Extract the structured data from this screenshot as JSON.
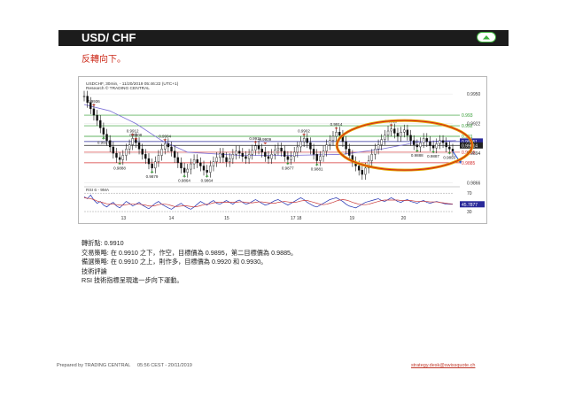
{
  "header": {
    "title": "USD/ CHF",
    "nav_icon": "chevron-up-icon"
  },
  "subtitle": "反轉向下。",
  "chart_data": {
    "type": "line",
    "info_line_1": "USDCHF, 30min, - 11/20/2019 05:46:22 (UTC+1)",
    "info_line_2": "Research © TRADING CENTRAL",
    "ylim": [
      0.9864,
      0.9956
    ],
    "yticks": [
      0.995,
      0.9922,
      0.9894,
      0.9866
    ],
    "x_dates": [
      "13",
      "14",
      "15",
      "17 18",
      "19",
      "20"
    ],
    "levels": [
      {
        "value": 0.993,
        "label": "0.993",
        "color": "#2e9a2e"
      },
      {
        "value": 0.992,
        "label": "0.992",
        "color": "#2e9a2e"
      },
      {
        "value": 0.991,
        "label": "0.991",
        "color": "#2e9a2e"
      },
      {
        "value": 0.99051,
        "label": "0.99051",
        "color": "#2a2a9a"
      },
      {
        "value": 0.99014,
        "label": "0.99014",
        "color": "#222222"
      },
      {
        "value": 0.9895,
        "label": "0.9895",
        "color": "#d43030"
      },
      {
        "value": 0.9885,
        "label": "0.9885",
        "color": "#d43030"
      }
    ],
    "price": [
      0.9948,
      0.9942,
      0.9936,
      0.993,
      0.9925,
      0.9918,
      0.9912,
      0.9906,
      0.99,
      0.9894,
      0.989,
      0.9888,
      0.9892,
      0.9898,
      0.9902,
      0.9908,
      0.9904,
      0.9898,
      0.9893,
      0.9889,
      0.9884,
      0.988,
      0.9886,
      0.9892,
      0.9898,
      0.9903,
      0.99,
      0.9896,
      0.989,
      0.9885,
      0.988,
      0.9876,
      0.9879,
      0.9884,
      0.9888,
      0.9885,
      0.9882,
      0.9878,
      0.9876,
      0.9882,
      0.9886,
      0.989,
      0.9894,
      0.989,
      0.9886,
      0.9889,
      0.9893,
      0.9896,
      0.9894,
      0.9891,
      0.9889,
      0.9893,
      0.9897,
      0.9901,
      0.9898,
      0.9895,
      0.9891,
      0.9889,
      0.9893,
      0.9897,
      0.9899,
      0.9896,
      0.9891,
      0.9888,
      0.9891,
      0.9895,
      0.99,
      0.9905,
      0.9908,
      0.9904,
      0.9898,
      0.9893,
      0.9887,
      0.9891,
      0.9896,
      0.9902,
      0.9906,
      0.991,
      0.9914,
      0.9911,
      0.9905,
      0.9898,
      0.9892,
      0.9886,
      0.9882,
      0.9878,
      0.9874,
      0.988,
      0.9887,
      0.9893,
      0.9898,
      0.9902,
      0.9907,
      0.9911,
      0.9915,
      0.9917,
      0.9913,
      0.991,
      0.9914,
      0.9916,
      0.9911,
      0.9906,
      0.9902,
      0.99,
      0.9904,
      0.9908,
      0.9905,
      0.9901,
      0.9899,
      0.9903,
      0.9906,
      0.9904,
      0.99,
      0.9898,
      0.9896
    ],
    "forecast": [
      [
        0.9896,
        0.9886
      ]
    ],
    "ma_line": [
      [
        0,
        0.994
      ],
      [
        8,
        0.9934
      ],
      [
        16,
        0.9922
      ],
      [
        24,
        0.9906
      ],
      [
        32,
        0.9895
      ],
      [
        48,
        0.9892
      ],
      [
        64,
        0.9892
      ],
      [
        80,
        0.9893
      ],
      [
        92,
        0.9898
      ],
      [
        104,
        0.9905
      ],
      [
        115,
        0.9906
      ]
    ],
    "point_labels": [
      {
        "text": "0.9936",
        "i": 3,
        "v": 0.9936,
        "pos": "above"
      },
      {
        "text": "0.9917",
        "i": 6,
        "v": 0.9912,
        "pos": "below"
      },
      {
        "text": "0.9888",
        "i": 11,
        "v": 0.9888,
        "pos": "below"
      },
      {
        "text": "0.9912",
        "i": 15,
        "v": 0.9908,
        "pos": "above"
      },
      {
        "text": "0.9908",
        "i": 16,
        "v": 0.9904,
        "pos": "above"
      },
      {
        "text": "0.9879",
        "i": 21,
        "v": 0.988,
        "pos": "below"
      },
      {
        "text": "0.9904",
        "i": 25,
        "v": 0.9903,
        "pos": "above"
      },
      {
        "text": "0.9864",
        "i": 31,
        "v": 0.9876,
        "pos": "below"
      },
      {
        "text": "0.9864",
        "i": 38,
        "v": 0.9876,
        "pos": "below"
      },
      {
        "text": "0.9911",
        "i": 53,
        "v": 0.9901,
        "pos": "above"
      },
      {
        "text": "0.9909",
        "i": 56,
        "v": 0.99,
        "pos": "above"
      },
      {
        "text": "0.9877",
        "i": 63,
        "v": 0.9888,
        "pos": "below"
      },
      {
        "text": "0.9902",
        "i": 68,
        "v": 0.9908,
        "pos": "above"
      },
      {
        "text": "0.9881",
        "i": 72,
        "v": 0.9887,
        "pos": "below"
      },
      {
        "text": "0.9914",
        "i": 78,
        "v": 0.9914,
        "pos": "above"
      },
      {
        "text": "0.9919",
        "i": 95,
        "v": 0.9917,
        "pos": "above"
      },
      {
        "text": "0.9888",
        "i": 103,
        "v": 0.99,
        "pos": "below"
      },
      {
        "text": "0.9887",
        "i": 108,
        "v": 0.9899,
        "pos": "below"
      },
      {
        "text": "0.9893",
        "i": 113,
        "v": 0.9898,
        "pos": "below"
      }
    ],
    "rsi": {
      "title": "RSI 6 - 9MA",
      "ylim": [
        30,
        80
      ],
      "yticks": [
        70,
        30
      ],
      "last_label": "45.7877",
      "values": [
        62,
        58,
        66,
        55,
        48,
        52,
        44,
        40,
        46,
        50,
        42,
        38,
        45,
        52,
        48,
        42,
        46,
        50,
        44,
        40,
        36,
        42,
        48,
        52,
        46,
        42,
        38,
        35,
        40,
        44,
        48,
        42,
        38,
        35,
        40,
        46,
        52,
        48,
        44,
        50,
        54,
        48,
        46,
        50,
        54,
        50,
        46,
        52,
        55,
        50,
        46,
        48,
        52,
        56,
        52,
        48,
        44,
        46,
        50,
        54,
        56,
        52,
        48,
        44,
        48,
        52,
        56,
        60,
        56,
        50,
        46,
        42,
        40,
        44,
        48,
        52,
        56,
        58,
        60,
        56,
        52,
        46,
        42,
        40,
        38,
        42,
        46,
        50,
        52,
        54,
        56,
        58,
        54,
        52,
        56,
        60,
        56,
        52,
        50,
        54,
        56,
        52,
        50,
        48,
        52,
        54,
        50,
        48,
        50,
        52,
        50,
        48,
        46,
        46,
        45.8
      ],
      "ma": [
        60,
        59,
        58,
        56,
        53,
        51,
        49,
        47,
        46,
        46,
        45,
        44,
        44,
        45,
        46,
        46,
        46,
        46,
        45,
        44,
        42,
        42,
        43,
        45,
        46,
        46,
        45,
        43,
        41,
        41,
        42,
        43,
        42,
        41,
        40,
        41,
        43,
        45,
        46,
        47,
        49,
        50,
        50,
        50,
        50,
        50,
        50,
        50,
        51,
        51,
        50,
        49,
        49,
        50,
        51,
        51,
        50,
        49,
        48,
        48,
        50,
        51,
        52,
        51,
        50,
        50,
        51,
        53,
        54,
        54,
        52,
        50,
        48,
        46,
        45,
        46,
        48,
        50,
        53,
        55,
        56,
        55,
        53,
        50,
        48,
        46,
        45,
        45,
        46,
        48,
        50,
        52,
        54,
        55,
        55,
        55,
        55,
        55,
        54,
        54,
        54,
        54,
        53,
        52,
        52,
        52,
        52,
        51,
        51,
        51,
        50,
        49,
        48,
        47,
        46.5
      ]
    }
  },
  "analysis": {
    "pivot_label": "轉折點",
    "pivot_value": "0.9910",
    "strategy_line": "交易策略: 在 0.9910 之下，作空，目標價為 0.9895，第二目標價為 0.9885。",
    "alternative_line": "備選策略: 在 0.9910 之上，則作多，目標價為 0.9920 和 0.9930。",
    "comment_title": "技術評論",
    "comment_text": "RSI 技術指標呈現進一步向下運動。"
  },
  "footer": {
    "prepared_by": "Prepared by TRADING CENTRAL",
    "timestamp": "05:56 CEST - 20/11/2019",
    "email": "strategy.desk@swissquote.ch"
  }
}
